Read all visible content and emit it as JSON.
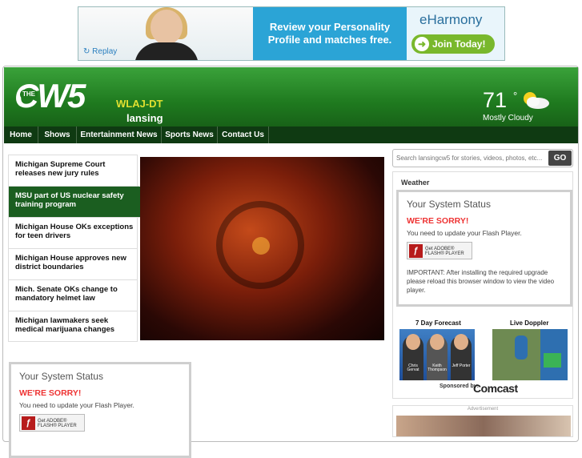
{
  "ad_banner": {
    "replay": "Replay",
    "headline": "Review your Personality Profile and matches free.",
    "brand": "eHarmony",
    "cta": "Join Today!"
  },
  "header": {
    "logo": "CW5",
    "logo_small": "THE",
    "callsign": "WLAJ-DT",
    "city": "lansing",
    "temp": "71",
    "deg": "°",
    "condition": "Mostly Cloudy"
  },
  "nav": [
    "Home",
    "Shows",
    "Entertainment News",
    "Sports News",
    "Contact Us"
  ],
  "news": [
    "Michigan Supreme Court releases new jury rules",
    "MSU part of US nuclear safety training program",
    "Michigan House OKs exceptions for teen drivers",
    "Michigan House approves new district boundaries",
    "Mich. Senate OKs change to mandatory helmet law",
    "Michigan lawmakers seek medical marijuana changes"
  ],
  "active_news_index": 1,
  "search": {
    "placeholder": "Search lansingcw5 for stories, videos, photos, etc...",
    "button": "GO"
  },
  "weather": {
    "title": "Weather",
    "forecast_label": "7 Day Forecast",
    "doppler_label": "Live Doppler",
    "anchors": [
      "Chris Gervat",
      "Keith Thompson",
      "Jeff Porter"
    ],
    "sponsored_by": "Sponsored by:",
    "sponsor": "Comcast"
  },
  "status_box": {
    "title": "Your System Status",
    "sorry": "WE'RE SORRY!",
    "need": "You need to update your Flash Player.",
    "flash_line1": "Get ADOBE®",
    "flash_line2": "FLASH® PLAYER",
    "important": "IMPORTANT: After installing the required upgrade please reload this browser window to view the video player."
  },
  "ad2": {
    "label": "Advertisement"
  }
}
